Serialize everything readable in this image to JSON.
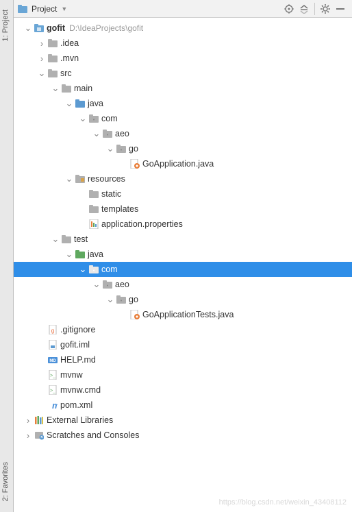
{
  "toolbar": {
    "title": "Project"
  },
  "rail": {
    "top": "1: Project",
    "bottom": "2: Favorites"
  },
  "watermark": "https://blog.csdn.net/weixin_43408112",
  "tree": [
    {
      "d": 0,
      "ar": "v",
      "ic": "module",
      "label": "gofit",
      "bold": true,
      "path": "D:\\IdeaProjects\\gofit"
    },
    {
      "d": 1,
      "ar": ">",
      "ic": "folder",
      "label": ".idea"
    },
    {
      "d": 1,
      "ar": ">",
      "ic": "folder",
      "label": ".mvn"
    },
    {
      "d": 1,
      "ar": "v",
      "ic": "folder",
      "label": "src"
    },
    {
      "d": 2,
      "ar": "v",
      "ic": "folder",
      "label": "main"
    },
    {
      "d": 3,
      "ar": "v",
      "ic": "src-folder",
      "label": "java"
    },
    {
      "d": 4,
      "ar": "v",
      "ic": "package",
      "label": "com"
    },
    {
      "d": 5,
      "ar": "v",
      "ic": "package",
      "label": "aeo"
    },
    {
      "d": 6,
      "ar": "v",
      "ic": "package",
      "label": "go"
    },
    {
      "d": 7,
      "ar": "",
      "ic": "java-main",
      "label": "GoApplication.java"
    },
    {
      "d": 3,
      "ar": "v",
      "ic": "res-folder",
      "label": "resources"
    },
    {
      "d": 4,
      "ar": "",
      "ic": "folder",
      "label": "static"
    },
    {
      "d": 4,
      "ar": "",
      "ic": "folder",
      "label": "templates"
    },
    {
      "d": 4,
      "ar": "",
      "ic": "props",
      "label": "application.properties"
    },
    {
      "d": 2,
      "ar": "v",
      "ic": "folder",
      "label": "test"
    },
    {
      "d": 3,
      "ar": "v",
      "ic": "test-folder",
      "label": "java"
    },
    {
      "d": 4,
      "ar": "v",
      "ic": "package",
      "label": "com",
      "selected": true
    },
    {
      "d": 5,
      "ar": "v",
      "ic": "package",
      "label": "aeo"
    },
    {
      "d": 6,
      "ar": "v",
      "ic": "package",
      "label": "go"
    },
    {
      "d": 7,
      "ar": "",
      "ic": "java-main",
      "label": "GoApplicationTests.java"
    },
    {
      "d": 1,
      "ar": "",
      "ic": "file-git",
      "label": ".gitignore"
    },
    {
      "d": 1,
      "ar": "",
      "ic": "file-iml",
      "label": "gofit.iml"
    },
    {
      "d": 1,
      "ar": "",
      "ic": "file-md",
      "label": "HELP.md"
    },
    {
      "d": 1,
      "ar": "",
      "ic": "file-sh",
      "label": "mvnw"
    },
    {
      "d": 1,
      "ar": "",
      "ic": "file-sh",
      "label": "mvnw.cmd"
    },
    {
      "d": 1,
      "ar": "",
      "ic": "file-pom",
      "label": "pom.xml"
    },
    {
      "d": 0,
      "ar": ">",
      "ic": "libs",
      "label": "External Libraries"
    },
    {
      "d": 0,
      "ar": ">",
      "ic": "scratches",
      "label": "Scratches and Consoles"
    }
  ]
}
